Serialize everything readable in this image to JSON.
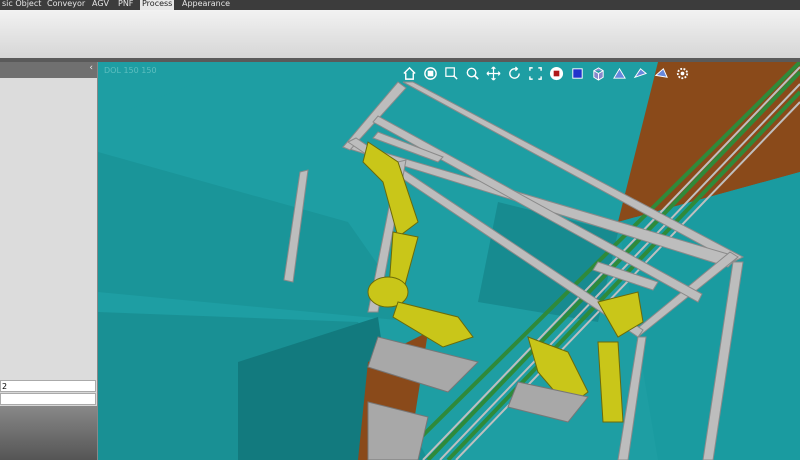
{
  "menu": {
    "tabs": [
      {
        "label": "sic Object"
      },
      {
        "label": "Conveyor"
      },
      {
        "label": "AGV"
      },
      {
        "label": "PNF"
      },
      {
        "label": "Process"
      },
      {
        "label": "Appearance"
      }
    ],
    "active": "Process"
  },
  "left_panel": {
    "collapse_glyph": "‹",
    "field_value": "2"
  },
  "viewport": {
    "coord_text": "DOL 150 150",
    "toolbar_icons": [
      "home-icon",
      "view-cube-icon",
      "zoom-window-icon",
      "zoom-icon",
      "pan-icon",
      "rotate-icon",
      "fit-icon",
      "stop-icon",
      "color-icon",
      "box-icon",
      "view-front-icon",
      "view-side-icon",
      "view-top-icon",
      "settings-icon"
    ]
  },
  "colors": {
    "floor": "#1e9ea3",
    "floor_shadow": "#17858a",
    "frame": "#bdbdbd",
    "robot": "#c9c619",
    "conveyor": "#2f8a3a",
    "wall": "#8a4a1a"
  }
}
